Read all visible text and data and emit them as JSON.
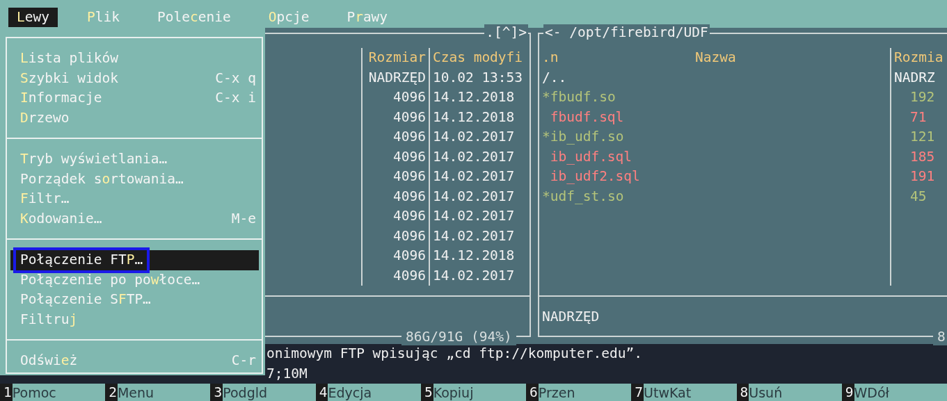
{
  "menubar": [
    {
      "hot": "L",
      "post": "ewy",
      "selected": true
    },
    {
      "hot": "P",
      "post": "lik",
      "selected": false
    },
    {
      "pre": "Pole",
      "hot": "c",
      "post": "enie",
      "selected": false
    },
    {
      "hot": "O",
      "post": "pcje",
      "selected": false
    },
    {
      "pre": "P",
      "hot": "r",
      "post": "awy",
      "selected": false
    }
  ],
  "menu": {
    "sections": [
      {
        "items": [
          {
            "hot": "L",
            "post": "ista plików",
            "selected": false
          },
          {
            "hot": "S",
            "post": "zybki widok",
            "shortcut": "C-x q",
            "selected": false
          },
          {
            "hot": "I",
            "post": "nformacje",
            "shortcut": "C-x i",
            "selected": false
          },
          {
            "hot": "D",
            "post": "rzewo",
            "selected": false
          }
        ]
      },
      {
        "items": [
          {
            "hot": "T",
            "post": "ryb wyświetlania…",
            "selected": false
          },
          {
            "pre": "Porządek s",
            "hot": "o",
            "post": "rtowania…",
            "selected": false
          },
          {
            "hot": "F",
            "post": "iltr…",
            "selected": false
          },
          {
            "hot": "K",
            "post": "odowanie…",
            "shortcut": "M-e",
            "selected": false
          }
        ]
      },
      {
        "items": [
          {
            "pre": "Połączenie FT",
            "hot": "P",
            "post": "…",
            "selected": true,
            "outlined": true
          },
          {
            "pre": "Połączenie po po",
            "hot": "w",
            "post": "łoce…",
            "selected": false
          },
          {
            "pre": "Połączenie S",
            "hot": "F",
            "post": "TP…",
            "selected": false
          },
          {
            "pre": "Filtru",
            "hot": "j",
            "selected": false
          }
        ]
      },
      {
        "items": [
          {
            "pre": "Odświ",
            "hot": "e",
            "post": "ż",
            "shortcut": "C-r",
            "selected": false
          }
        ]
      }
    ]
  },
  "left_panel": {
    "title": ".[^]>",
    "columns": [
      "Rozmiar",
      "Czas modyfi"
    ],
    "rows": [
      {
        "size": "NADRZĘD",
        "date": "10.02 13:53"
      },
      {
        "size": "4096",
        "date": "14.12.2018"
      },
      {
        "size": "4096",
        "date": "14.12.2018"
      },
      {
        "size": "4096",
        "date": "14.02.2017"
      },
      {
        "size": "4096",
        "date": "14.02.2017"
      },
      {
        "size": "4096",
        "date": "14.02.2017"
      },
      {
        "size": "4096",
        "date": "14.02.2017"
      },
      {
        "size": "4096",
        "date": "14.02.2017"
      },
      {
        "size": "4096",
        "date": "14.02.2017"
      },
      {
        "size": "4096",
        "date": "14.12.2018"
      },
      {
        "size": "4096",
        "date": "14.02.2017"
      }
    ],
    "disk": "86G/91G (94%)"
  },
  "right_panel": {
    "title": "<- /opt/firebird/UDF",
    "sort": ".n",
    "columns": [
      "Nazwa",
      "Rozmia"
    ],
    "rows": [
      {
        "name": "/..",
        "size": "NADRZ",
        "kind": "dir"
      },
      {
        "name": "*fbudf.so",
        "size": "192",
        "kind": "exec"
      },
      {
        "name": "fbudf.sql",
        "size": "71",
        "kind": "file"
      },
      {
        "name": "*ib_udf.so",
        "size": "121",
        "kind": "exec"
      },
      {
        "name": "ib_udf.sql",
        "size": "185",
        "kind": "file"
      },
      {
        "name": "ib_udf2.sql",
        "size": "191",
        "kind": "file"
      },
      {
        "name": "*udf_st.so",
        "size": "45",
        "kind": "exec"
      }
    ],
    "status": "NADRZĘD",
    "disk": "8"
  },
  "command_lines": [
    "onimowym FTP wpisując „cd ftp://komputer.edu”.",
    "7;10M"
  ],
  "fkeys": [
    {
      "num": "1",
      "label": "Pomoc"
    },
    {
      "num": "2",
      "label": "Menu"
    },
    {
      "num": "3",
      "label": "Podgld"
    },
    {
      "num": "4",
      "label": "Edycja"
    },
    {
      "num": "5",
      "label": "Kopiuj"
    },
    {
      "num": "6",
      "label": "Przen"
    },
    {
      "num": "7",
      "label": "UtwKat"
    },
    {
      "num": "8",
      "label": "Usuń"
    },
    {
      "num": "9",
      "label": "WDół"
    }
  ]
}
